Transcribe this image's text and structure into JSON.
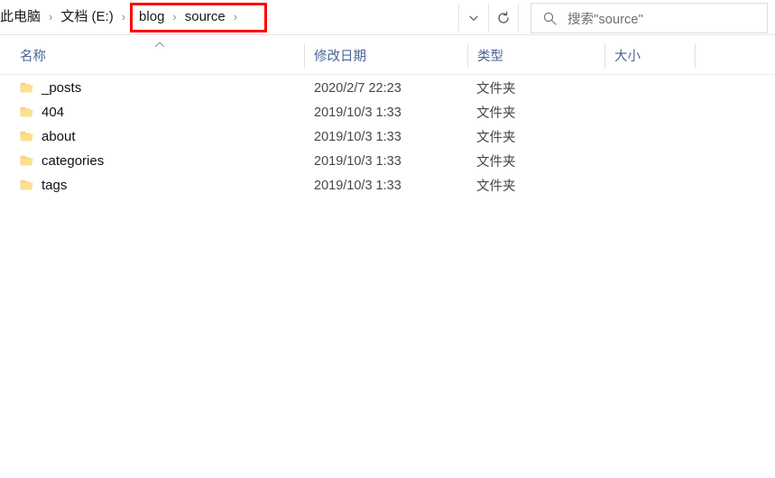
{
  "addressbar": {
    "breadcrumbs": [
      {
        "label": "此电脑",
        "separator": "›"
      },
      {
        "label": "文档 (E:)",
        "separator": "›"
      },
      {
        "label": "blog",
        "separator": "›"
      },
      {
        "label": "source",
        "separator": "›"
      }
    ],
    "dropdown_icon": "chevron-down-icon",
    "refresh_icon": "refresh-icon",
    "highlight_color": "#ff0000",
    "highlighted_crumbs": [
      "blog",
      "source"
    ]
  },
  "search": {
    "placeholder": "搜索\"source\"",
    "icon": "search-icon"
  },
  "columns": [
    {
      "key": "name",
      "label": "名称",
      "sorted": "ascending"
    },
    {
      "key": "date",
      "label": "修改日期"
    },
    {
      "key": "type",
      "label": "类型"
    },
    {
      "key": "size",
      "label": "大小"
    }
  ],
  "files": [
    {
      "icon": "folder-icon",
      "name": "_posts",
      "date": "2020/2/7 22:23",
      "type": "文件夹",
      "size": ""
    },
    {
      "icon": "folder-icon",
      "name": "404",
      "date": "2019/10/3 1:33",
      "type": "文件夹",
      "size": ""
    },
    {
      "icon": "folder-icon",
      "name": "about",
      "date": "2019/10/3 1:33",
      "type": "文件夹",
      "size": ""
    },
    {
      "icon": "folder-icon",
      "name": "categories",
      "date": "2019/10/3 1:33",
      "type": "文件夹",
      "size": ""
    },
    {
      "icon": "folder-icon",
      "name": "tags",
      "date": "2019/10/3 1:33",
      "type": "文件夹",
      "size": ""
    }
  ],
  "colors": {
    "folder": "#f7d777",
    "folder_dark": "#e8c65c",
    "header_text": "#4a6594",
    "annotation": "#ff0000"
  }
}
